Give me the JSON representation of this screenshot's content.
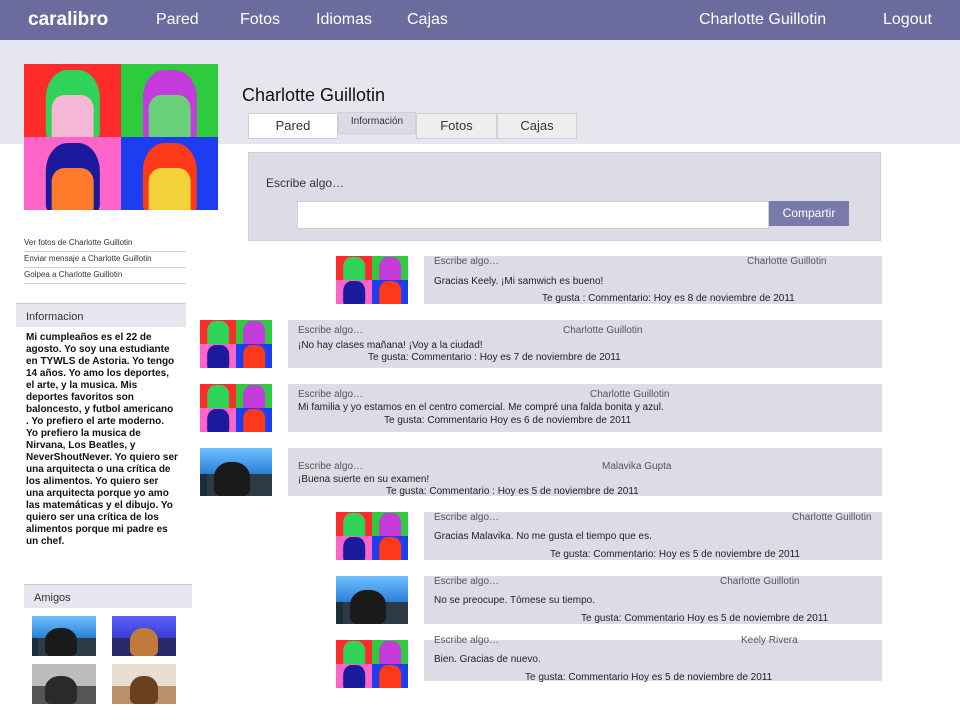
{
  "topbar": {
    "brand": "caralibro",
    "nav": [
      "Pared",
      "Fotos",
      "Idiomas",
      "Cajas"
    ],
    "user": "Charlotte Guillotin",
    "logout": "Logout"
  },
  "profile": {
    "name": "Charlotte Guillotin",
    "tabs": [
      "Pared",
      "Información",
      "Fotos",
      "Cajas"
    ]
  },
  "sidebar": {
    "links": [
      "Ver fotos de Charlotte Guillotin",
      "Enviar mensaje a Charlotte Guillotin",
      "Golpea a Charlotte Guillotin"
    ],
    "info_heading": "Informacion",
    "bio": "Mi cumpleaños es el 22 de agosto. Yo soy una estudiante en TYWLS de Astoria. Yo tengo 14 años. Yo amo los deportes, el arte, y la musica. Mis deportes favoritos  son baloncesto, y futbol americano . Yo prefiero el arte moderno. Yo prefiero la musica de Nirvana, Los Beatles, y NeverShoutNever. Yo quiero ser una arquitecta o una crítica de los alimentos. Yo quiero ser una arquitecta porque yo amo las matemáticas y el dibujo. Yo quiero ser una crítica de los alimentos porque mi padre es un chef.",
    "friends_heading": "Amigos"
  },
  "compose": {
    "label": "Escribe algo…",
    "placeholder": "",
    "button": "Compartir"
  },
  "posts": [
    {
      "prompt": "Escribe algo…",
      "author": "Charlotte Guillotin",
      "message": "Gracias Keely. ¡Mi samwich es bueno!",
      "meta": "Te gusta : Commentario: Hoy es 8 de noviembre de 2011"
    },
    {
      "prompt": "Escribe algo…",
      "author": "Charlotte Guillotin",
      "message": "¡No hay clases mañana! ¡Voy a la ciudad!",
      "meta": "Te gusta:  Commentario  :     Hoy es 7 de noviembre de 2011"
    },
    {
      "prompt": "Escribe algo…",
      "author": "Charlotte Guillotin",
      "message": "Mi familia y yo estamos en el centro comercial. Me compré una falda bonita y azul.",
      "meta": "Te gusta:      Commentario   Hoy es 6 de noviembre de 2011"
    },
    {
      "prompt": "Escribe algo…",
      "author": "Malavika Gupta",
      "message": "¡Buena suerte en su examen!",
      "meta": "Te gusta: Commentario :   Hoy es 5 de noviembre de 2011"
    },
    {
      "prompt": "Escribe algo…",
      "author": "Charlotte Guillotin",
      "message": "Gracias Malavika. No me gusta el tiempo que es.",
      "meta": "Te gusta:      Commentario:          Hoy es 5 de noviembre de 2011"
    },
    {
      "prompt": "Escribe algo…",
      "author": "Charlotte Guillotin",
      "message": "No se preocupe. Tómese su tiempo.",
      "meta": "Te gusta: Commentario      Hoy es 5 de noviembre de 2011"
    },
    {
      "prompt": "Escribe algo…",
      "author": "Keely Rivera",
      "message": "Bien. Gracias de nuevo.",
      "meta": "Te gusta: Commentario     Hoy es 5 de noviembre de 2011"
    }
  ],
  "colors": {
    "topbar": "#6b6b9e",
    "band": "#e6e6ee",
    "post_bg": "#dcdce6",
    "button": "#7a7aaa"
  }
}
